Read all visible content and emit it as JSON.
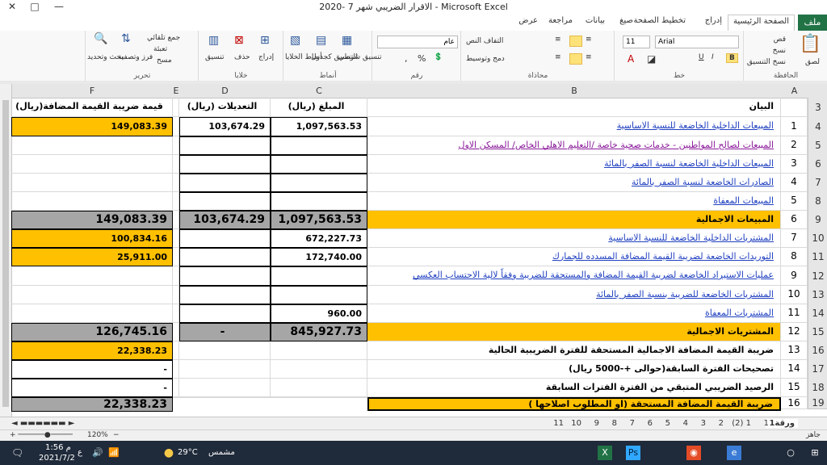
{
  "window": {
    "title": "الاقرار الضريبي شهر 7 -2020  -  Microsoft Excel"
  },
  "tabs": [
    "ملف",
    "الصفحة الرئيسية",
    "إدراج",
    "تخطيط الصفحة",
    "صيغ",
    "بيانات",
    "مراجعة",
    "عرض"
  ],
  "ribbon": {
    "clipboard": {
      "label": "الحافظة",
      "paste": "لصق",
      "cut": "قص",
      "copy": "نسخ",
      "format_painter": "نسخ التنسيق"
    },
    "font": {
      "label": "خط",
      "name": "Arial",
      "size": "11"
    },
    "alignment": {
      "label": "محاذاة",
      "wrap": "التفاف النص",
      "merge": "دمج وتوسيط"
    },
    "number": {
      "label": "رقم",
      "format": "عام",
      "percent": "%",
      "comma": ","
    },
    "styles": {
      "label": "أنماط",
      "conditional": "تنسيق شرطي",
      "table": "التنسيق كجدول",
      "cell_styles": "أنماط الخلايا"
    },
    "cells": {
      "label": "خلايا",
      "insert": "إدراج",
      "delete": "حذف",
      "format": "تنسيق"
    },
    "editing": {
      "label": "تحرير",
      "autosum": "جمع تلقائي",
      "fill": "تعبئة",
      "clear": "مسح",
      "sort": "فرز وتصفية",
      "find": "بحث وتحديد"
    }
  },
  "columns": [
    "A",
    "B",
    "C",
    "D",
    "E",
    "F"
  ],
  "header_row": {
    "row": "3",
    "b": "البيان",
    "c": "المبلغ (ريال)",
    "d": "التعديلات (ريال)",
    "f": "(ريال)قيمة ضريبة القيمة المضافة"
  },
  "rows": [
    {
      "row": "4",
      "a": "1",
      "b": "المبيعات الداخلية الخاضعة للنسبة الاساسية",
      "c": "1,097,563.53",
      "d": "103,674.29",
      "f": "149,083.39"
    },
    {
      "row": "5",
      "a": "2",
      "b": "المبيعات لصالح المواطنين - خدمات صحية خاصة /التعليم الاهلي الخاص/ المسكن الاول",
      "c": "",
      "d": "",
      "f": ""
    },
    {
      "row": "6",
      "a": "3",
      "b": "المبيعات الداخلية الخاضعة لنسبة الصفر بالمائة",
      "c": "",
      "d": "",
      "f": ""
    },
    {
      "row": "7",
      "a": "4",
      "b": "الصادرات الخاضعة لنسبة الصفر بالمائة",
      "c": "",
      "d": "",
      "f": ""
    },
    {
      "row": "8",
      "a": "5",
      "b": "المبيعات المعفاة",
      "c": "",
      "d": "",
      "f": ""
    },
    {
      "row": "9",
      "a": "6",
      "b": "المبيعات الاجمالية",
      "c": "1,097,563.53",
      "d": "103,674.29",
      "f": "149,083.39"
    },
    {
      "row": "10",
      "a": "7",
      "b": "المشتريات الداخلية الخاضعة للنسبة الاساسية",
      "c": "672,227.73",
      "d": "",
      "f": "100,834.16"
    },
    {
      "row": "11",
      "a": "8",
      "b": "التوريدات الخاضعة لضريبة القيمة المضافة المسدده للجمارك",
      "c": "172,740.00",
      "d": "",
      "f": "25,911.00"
    },
    {
      "row": "12",
      "a": "9",
      "b": "عمليات الاستيراد الخاضعة لضريبة القيمة المضافة والمستحقة للضريبة وفقاً لالية الاحتساب العكسي",
      "c": "",
      "d": "",
      "f": ""
    },
    {
      "row": "13",
      "a": "10",
      "b": "المشتريات الخاضعة للضريبة بنسبة الصفر بالمائة",
      "c": "",
      "d": "",
      "f": ""
    },
    {
      "row": "14",
      "a": "11",
      "b": "المشتريات المعفاة",
      "c": "960.00",
      "d": "",
      "f": ""
    },
    {
      "row": "15",
      "a": "12",
      "b": "المشتريات الاجمالية",
      "c": "845,927.73",
      "d": "-",
      "f": "126,745.16"
    },
    {
      "row": "16",
      "a": "13",
      "b": "ضريبة القيمة المضافة الاجمالية المستحقة للفترة الضريبية الحالية",
      "c": "",
      "d": "",
      "f": "22,338.23"
    },
    {
      "row": "17",
      "a": "14",
      "b": "تصحيحات الفترة السابقة(حوالى +-5000 ريال)",
      "c": "",
      "d": "",
      "f": "-"
    },
    {
      "row": "18",
      "a": "15",
      "b": "الرصيد الضريبي المتبقي من الفترة  الفترات السابقة",
      "c": "",
      "d": "",
      "f": "-"
    },
    {
      "row": "19",
      "a": "16",
      "b": "ضريبة القيمة المضافة المستحقة (او المطلوب اصلاحها )",
      "c": "",
      "d": "",
      "f": "22,338.23"
    }
  ],
  "sheet_tabs": [
    "ورقة1",
    "1",
    "(2) 1",
    "2",
    "3",
    "4",
    "5",
    "6",
    "7",
    "8",
    "9",
    "10",
    "11"
  ],
  "status": {
    "ready": "جاهز",
    "zoom": "120%"
  },
  "taskbar": {
    "weather": "مشمس",
    "temp": "29°C",
    "time": "1:56 م",
    "date": "2021/7/2",
    "lang": "ع"
  }
}
